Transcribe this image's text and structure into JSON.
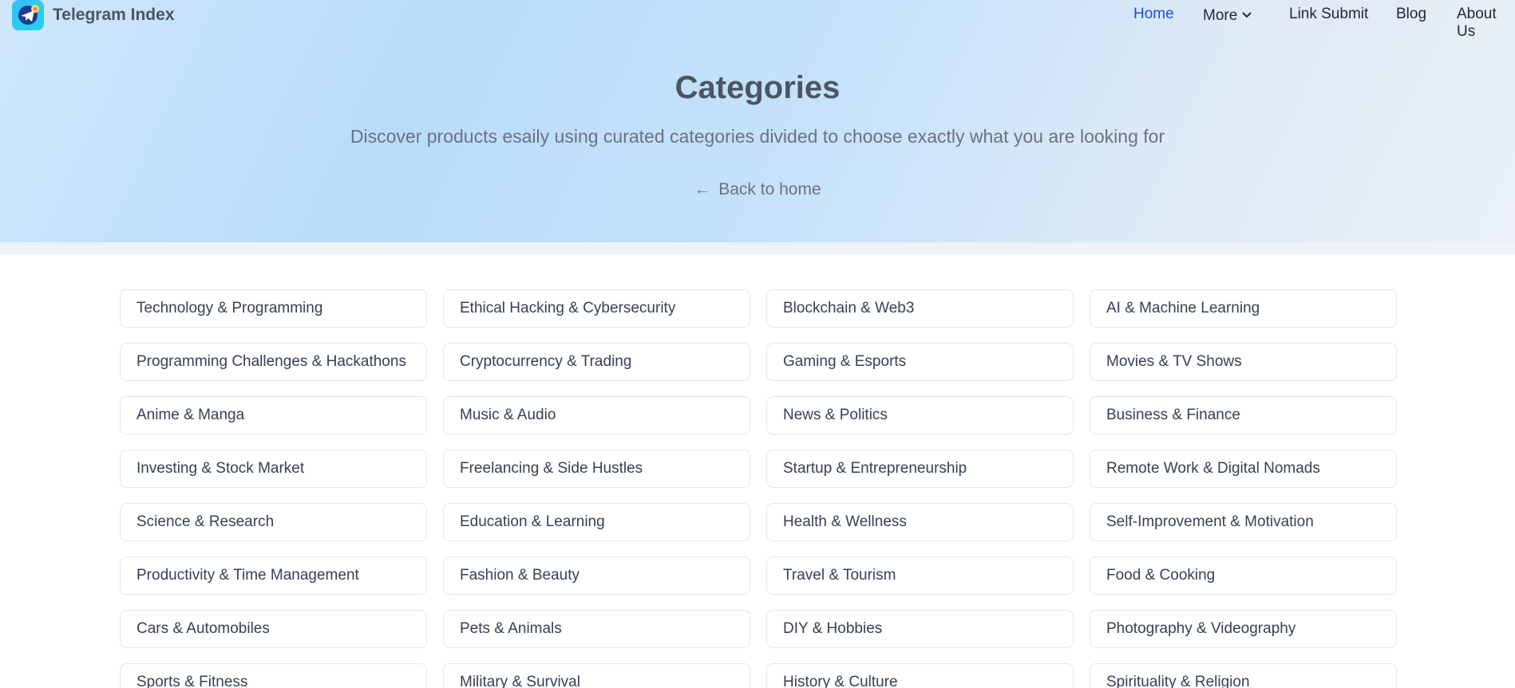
{
  "header": {
    "brand": "Telegram Index",
    "nav": [
      {
        "label": "Home"
      },
      {
        "label": "More"
      },
      {
        "label": "Link Submit"
      },
      {
        "label": "Blog"
      },
      {
        "label": "About Us"
      }
    ],
    "active": "Home"
  },
  "hero": {
    "title": "Categories",
    "subtitle": "Discover products esaily using curated categories divided to choose exactly what you are looking for",
    "back_link": "Back to home",
    "back_arrow": "←"
  },
  "categories": [
    "Technology & Programming",
    "Ethical Hacking & Cybersecurity",
    "Blockchain & Web3",
    "AI & Machine Learning",
    "Programming Challenges & Hackathons",
    "Cryptocurrency & Trading",
    "Gaming & Esports",
    "Movies & TV Shows",
    "Anime & Manga",
    "Music & Audio",
    "News & Politics",
    "Business & Finance",
    "Investing & Stock Market",
    "Freelancing & Side Hustles",
    "Startup & Entrepreneurship",
    "Remote Work & Digital Nomads",
    "Science & Research",
    "Education & Learning",
    "Health & Wellness",
    "Self-Improvement & Motivation",
    "Productivity & Time Management",
    "Fashion & Beauty",
    "Travel & Tourism",
    "Food & Cooking",
    "Cars & Automobiles",
    "Pets & Animals",
    "DIY & Hobbies",
    "Photography & Videography",
    "Sports & Fitness",
    "Military & Survival",
    "History & Culture",
    "Spirituality & Religion"
  ],
  "colors": {
    "accent": "#1d4ed8",
    "hero_gradient_start": "#b9dcfb",
    "hero_gradient_end": "#eaf0f6"
  },
  "icons": {
    "logo": "telegram-index-logo",
    "more_dropdown": "chevron-down-icon",
    "back": "arrow-left-icon"
  }
}
